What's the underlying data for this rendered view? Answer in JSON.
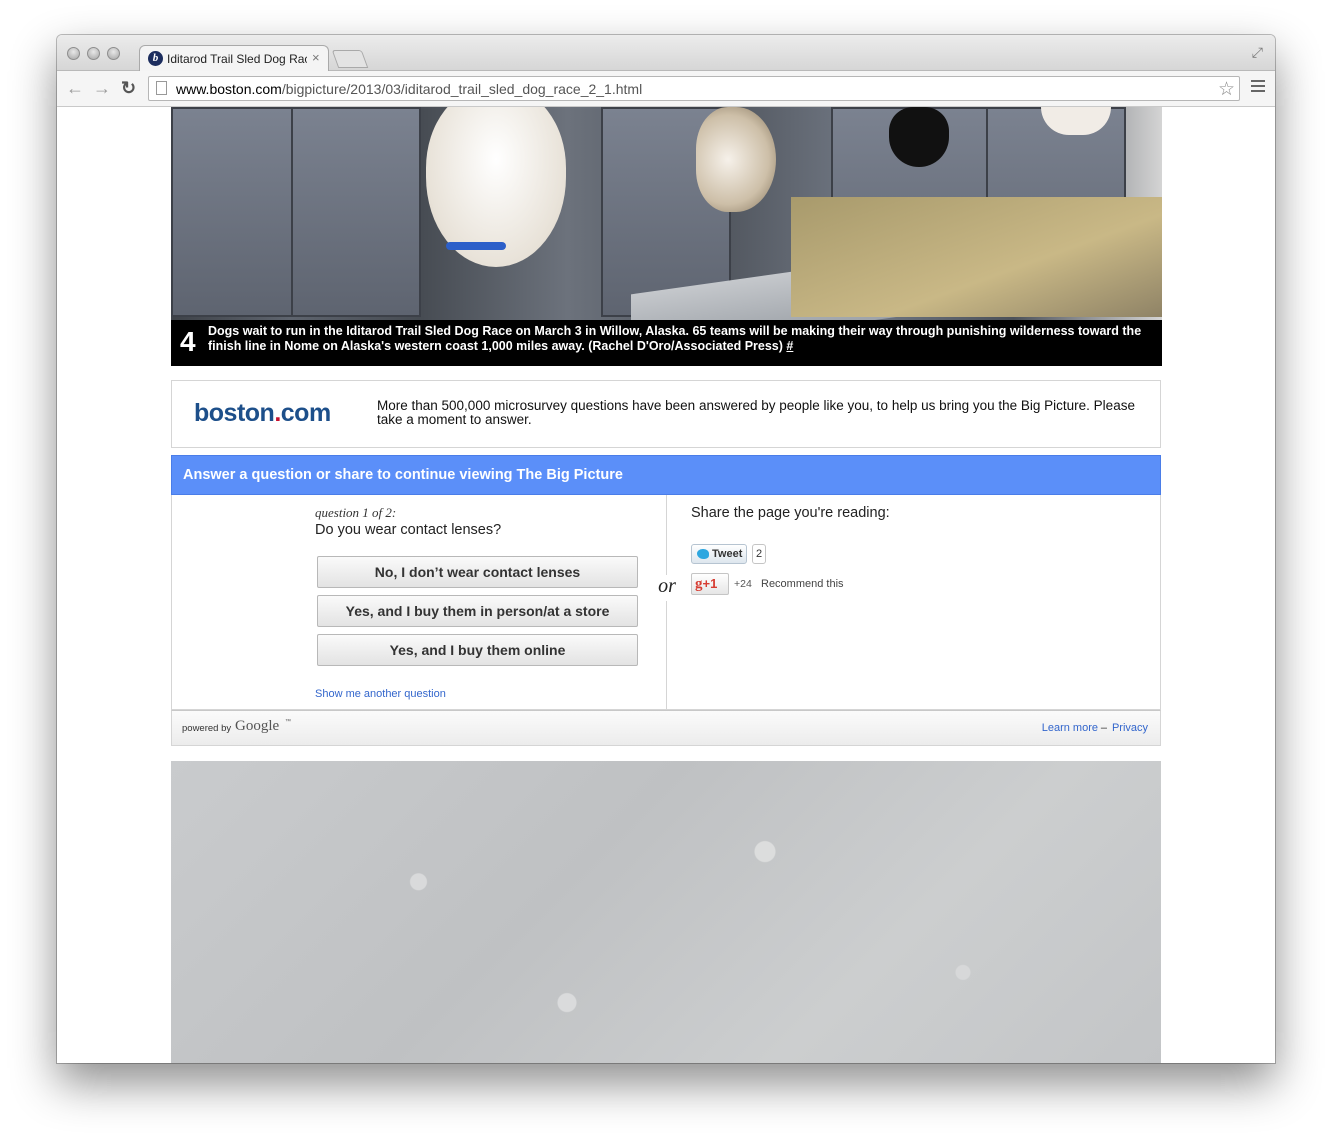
{
  "browser": {
    "tab_title": "Iditarod Trail Sled Dog Race",
    "tab_close": "×",
    "url_domain": "www.boston.com",
    "url_path": "/bigpicture/2013/03/iditarod_trail_sled_dog_race_2_1.html",
    "back_icon": "←",
    "forward_icon": "→",
    "reload_icon": "↻",
    "star_icon": "☆",
    "fullscreen_icon": "⤢"
  },
  "photo": {
    "number": "4",
    "caption": "Dogs wait to run in the Iditarod Trail Sled Dog Race on March 3 in Willow, Alaska. 65 teams will be making their way through punishing wilderness toward the finish line in Nome on Alaska's western coast 1,000 miles away. (Rachel D'Oro/Associated Press)",
    "permalink": "#"
  },
  "survey": {
    "logo_main": "boston",
    "logo_dot": ".",
    "logo_tail": "com",
    "intro": "More than 500,000 microsurvey questions have been answered by people like you, to help us bring you the Big Picture. Please take a moment to answer.",
    "prompt": "Answer a question or share to continue viewing The Big Picture",
    "question_count": "question 1 of 2:",
    "question": "Do you wear contact lenses?",
    "answers": [
      "No, I don’t wear contact lenses",
      "Yes, and I buy them in person/at a store",
      "Yes, and I buy them online"
    ],
    "another_question": "Show me another question",
    "or_label": "or",
    "share_label": "Share the page you're reading:",
    "tweet_label": "Tweet",
    "tweet_count": "2",
    "gplus_label": "+1",
    "gplus_count": "+24",
    "recommend_label": "Recommend this",
    "powered_by": "powered by",
    "google": "Google",
    "tm": "™",
    "learn_more": "Learn more",
    "dash": "–",
    "privacy": "Privacy"
  },
  "colors": {
    "prompt_bar": "#5b8ff9",
    "logo_blue": "#1d4f8a",
    "logo_red": "#c8102e",
    "link_blue": "#3366cc"
  }
}
